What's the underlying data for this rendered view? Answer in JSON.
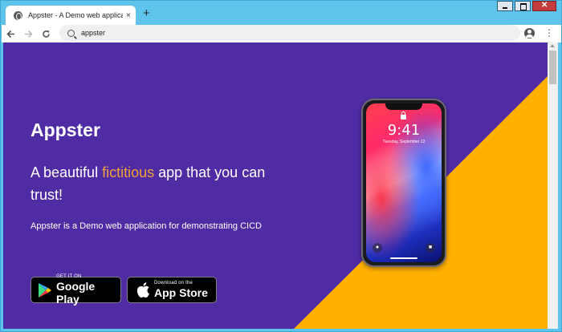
{
  "browser": {
    "tab_title": "Appster - A Demo web applicatio",
    "tab_close": "×",
    "new_tab": "+",
    "url": "appster",
    "menu": "⋮"
  },
  "window": {
    "close_label": "✕"
  },
  "hero": {
    "brand": "Appster",
    "headline_pre": "A beautiful ",
    "headline_highlight": "fictitious",
    "headline_post": " app that you can trust!",
    "description": "Appster is a Demo web application for demonstrating CICD",
    "accent_color": "#f2a23a",
    "background_color": "#4f2ca3",
    "secondary_color": "#ffb000"
  },
  "stores": {
    "google_small": "GET IT ON",
    "google_large": "Google Play",
    "apple_small": "Download on the",
    "apple_large": "App Store"
  },
  "phone": {
    "time": "9:41",
    "date": "Tuesday, September 12"
  }
}
